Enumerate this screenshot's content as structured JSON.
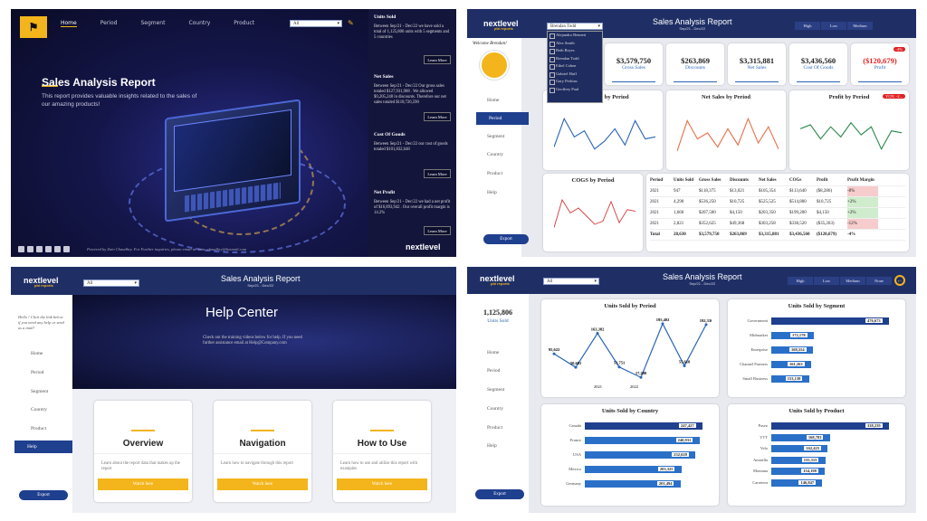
{
  "home": {
    "nav": [
      "Home",
      "Period",
      "Segment",
      "Country",
      "Product"
    ],
    "filter": "All",
    "title": "Sales Analysis Report",
    "description": "This report provides valuable insights related to the sales of our amazing products!",
    "footer": "Powered by Zain Chaudhry. For Further inquiries, please email at: zain_chaudhry@hotmail.com",
    "side": [
      {
        "title": "Units Sold",
        "text": "Between Sep/21 - Dec/22 we have sold a total of 1,125,806 units with 5 segments and 5 countries",
        "btn": "Learn More"
      },
      {
        "title": "Net Sales",
        "text": "Between Sep/21 - Dec/22 Our gross sales totaled $127,931,908 . We allowed $9,205,248 in discounts. Therefore our net sales totaled $118,726,590",
        "btn": "Learn More"
      },
      {
        "title": "Cost Of Goods",
        "text": "Between Sep/21 - Dec/22 our cost of goods totaled $101,832,648",
        "btn": "Learn More"
      },
      {
        "title": "Net Profit",
        "text": "Between Sep/21 - Dec/22 we had a net profit of $16,893,942 . Our overall profit margin is 14.2%",
        "btn": "Learn More"
      }
    ],
    "brand": "nextlevel"
  },
  "period": {
    "brand": "nextlevel",
    "brand_sub": "pbi reports",
    "title": "Sales Analysis Report",
    "subtitle": "Sep/21 - Dec/22",
    "filter": "Brendan Todd",
    "dropdown": [
      "Alejandro Bennett",
      "Alex Smith",
      "Beth Reyes",
      "Brendan Todd",
      "Ethel Cohen",
      "Gabriel Huff",
      "Gary Perkins",
      "Geoffrey Paul"
    ],
    "toggles": [
      "High",
      "Low",
      "Medium"
    ],
    "welcome": "Welcome Brendan!",
    "menu": [
      "Home",
      "Period",
      "Segment",
      "Country",
      "Product",
      "Help"
    ],
    "export": "Export",
    "kpis": [
      {
        "value": "$3,579,750",
        "label": "Gross Sales"
      },
      {
        "value": "$263,869",
        "label": "Discounts"
      },
      {
        "value": "$3,315,881",
        "label": "Net Sales"
      },
      {
        "value": "$3,436,560",
        "label": "Cost Of Goods"
      },
      {
        "value": "($120,679)",
        "label": "Profit",
        "badge": "-4%"
      }
    ],
    "charts": [
      "Units Sold by Period",
      "Net Sales by Period",
      "Profit by Period",
      "COGS by Period"
    ],
    "yoy": "YOY: -2...",
    "table": {
      "headers": [
        "Period",
        "Units Sold",
        "Gross Sales",
        "Discounts",
        "Net Sales",
        "COGs",
        "Profit",
        "Profit Margin"
      ],
      "rows": [
        [
          "2021",
          "947",
          "$118,375",
          "$13,021",
          "$105,354",
          "$113,640",
          "($8,286)",
          "-8%"
        ],
        [
          "2021",
          "4,290",
          "$536,250",
          "$10,725",
          "$525,525",
          "$514,800",
          "$10,725",
          "+2%"
        ],
        [
          "2021",
          "1,660",
          "$207,500",
          "$4,150",
          "$203,350",
          "$199,200",
          "$4,150",
          "+2%"
        ],
        [
          "2021",
          "2,821",
          "$352,625",
          "$49,368",
          "$303,258",
          "$338,520",
          "($35,263)",
          "-12%"
        ],
        [
          "Total",
          "28,630",
          "$3,579,750",
          "$263,869",
          "$3,315,881",
          "$3,436,560",
          "($120,679)",
          "-4%"
        ]
      ]
    }
  },
  "help": {
    "brand": "nextlevel",
    "brand_sub": "pbi reports",
    "title": "Sales Analysis Report",
    "subtitle": "Sep/21 - Dec/22",
    "filter": "All",
    "hello": "Hello ! Click the link below if you need any help or send us a mail!",
    "menu": [
      "Home",
      "Period",
      "Segment",
      "Country",
      "Product",
      "Help"
    ],
    "export": "Export",
    "center": "Help Center",
    "center_text": "Check out the training videos below for help. If you need further assistance email at Help@Company.com",
    "cards": [
      {
        "title": "Overview",
        "desc": "Learn about the report data that makes up the report",
        "btn": "Watch here"
      },
      {
        "title": "Navigation",
        "desc": "Learn how to navigate through this report",
        "btn": "Watch here"
      },
      {
        "title": "How to Use",
        "desc": "Learn how to use and utilize this report with examples",
        "btn": "Watch here"
      }
    ]
  },
  "units": {
    "brand": "nextlevel",
    "brand_sub": "pbi reports",
    "title": "Sales Analysis Report",
    "subtitle": "Sep/21 - Dec/22",
    "filter": "All",
    "toggles": [
      "High",
      "Low",
      "Medium",
      "None"
    ],
    "kpi_value": "1,125,806",
    "kpi_label": "Units Sold",
    "menu": [
      "Home",
      "Period",
      "Segment",
      "Country",
      "Product",
      "Help"
    ],
    "export": "Export",
    "charts": [
      "Units Sold by Period",
      "Units Sold by Segment",
      "Units Sold by Country",
      "Units Sold by Product"
    ]
  },
  "chart_data": [
    {
      "type": "line",
      "title": "Units Sold by Period",
      "x": [
        "2021",
        "2022"
      ],
      "series": [
        {
          "values": [
            95622,
            50681,
            163382,
            51751,
            17280,
            195402,
            55618,
            192336
          ]
        }
      ]
    },
    {
      "type": "bar",
      "title": "Units Sold by Segment",
      "categories": [
        "Government",
        "Midmarket",
        "Enterprise",
        "Channel Partners",
        "Small Business"
      ],
      "values": [
        476673,
        172178,
        168554,
        161263,
        153138
      ]
    },
    {
      "type": "bar",
      "title": "Units Sold by Country",
      "categories": [
        "Canada",
        "France",
        "USA",
        "Mexico",
        "Germany"
      ],
      "values": [
        247427,
        240931,
        232628,
        203325,
        201494
      ]
    },
    {
      "type": "bar",
      "title": "Units Sold by Product",
      "categories": [
        "Paseo",
        "VTT",
        "Velo",
        "Amarilla",
        "Montana",
        "Carretera"
      ],
      "values": [
        338239,
        168783,
        162425,
        155315,
        154198,
        146847
      ]
    }
  ]
}
